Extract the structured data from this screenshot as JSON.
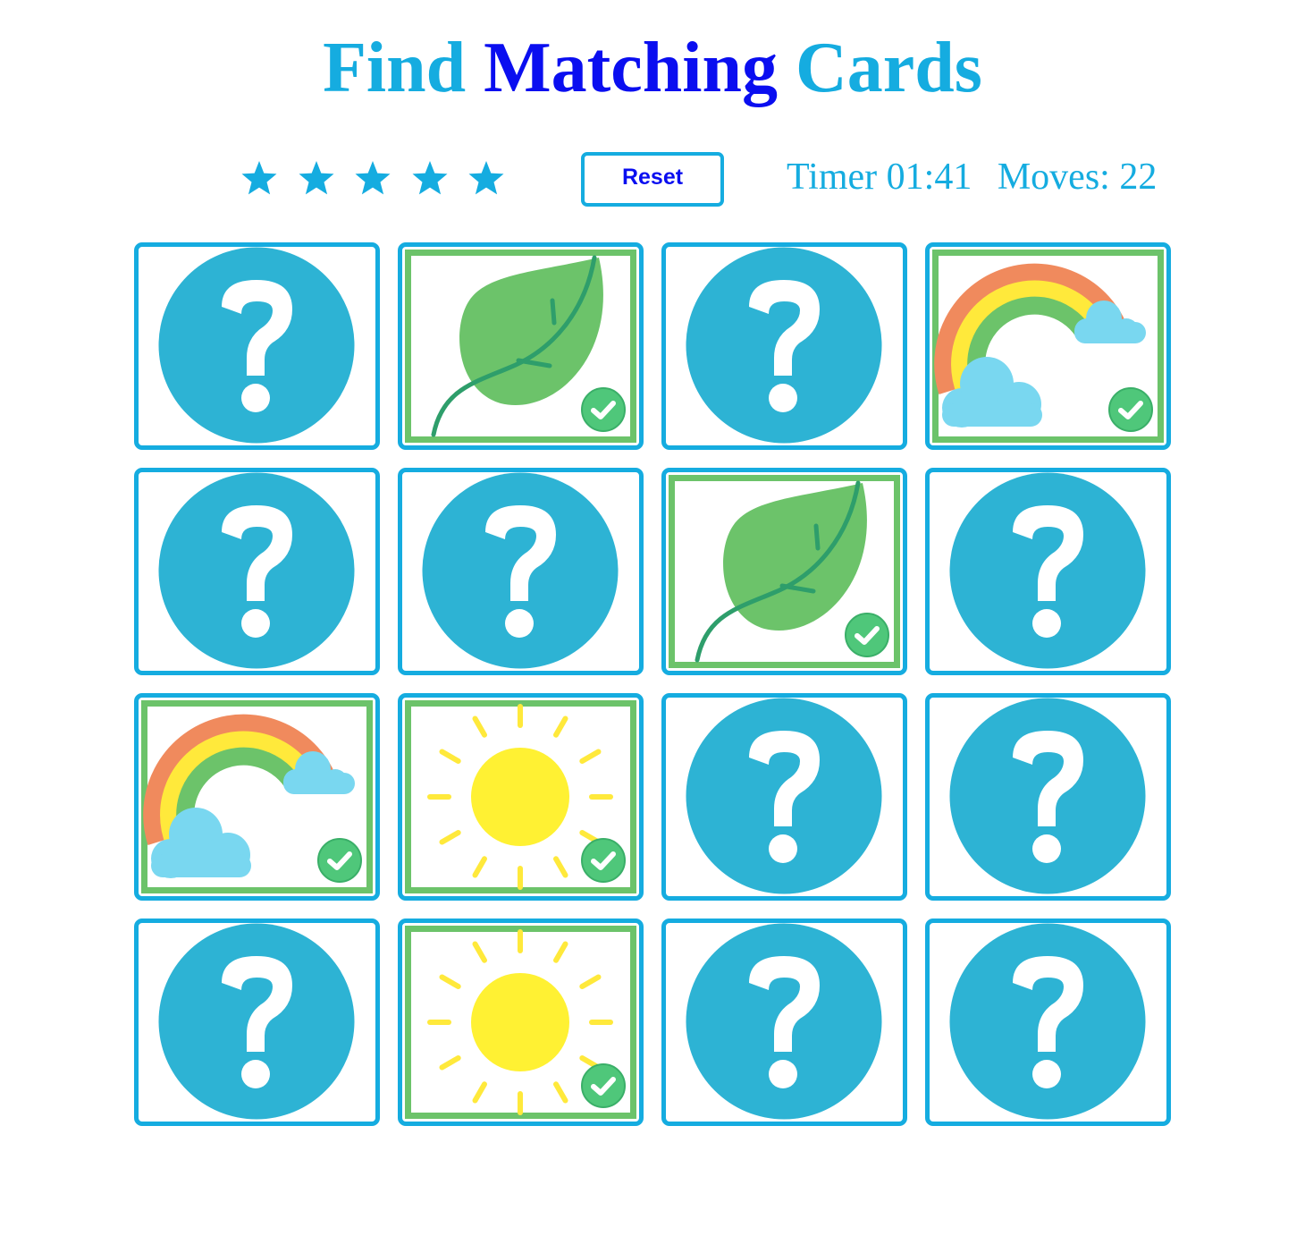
{
  "header": {
    "title_word_1": "Find",
    "title_word_2": "Matching",
    "title_word_3": "Cards"
  },
  "rating": {
    "stars": 5
  },
  "controls": {
    "reset_label": "Reset"
  },
  "stats": {
    "timer_label": "Timer",
    "timer_value": "01:41",
    "moves_label": "Moves:",
    "moves_value": "22"
  },
  "colors": {
    "accent": "#15ace0",
    "title_dark": "#0a0ef0",
    "matched_border": "#6cc36a",
    "hidden_card_circle": "#2db3d4"
  },
  "board": {
    "rows": 4,
    "cols": 4,
    "cards": [
      {
        "face": "hidden"
      },
      {
        "face": "leaf",
        "matched": true
      },
      {
        "face": "hidden"
      },
      {
        "face": "rainbow",
        "matched": true
      },
      {
        "face": "hidden"
      },
      {
        "face": "hidden"
      },
      {
        "face": "leaf",
        "matched": true
      },
      {
        "face": "hidden"
      },
      {
        "face": "rainbow",
        "matched": true
      },
      {
        "face": "sun",
        "matched": true
      },
      {
        "face": "hidden"
      },
      {
        "face": "hidden"
      },
      {
        "face": "hidden"
      },
      {
        "face": "sun",
        "matched": true
      },
      {
        "face": "hidden"
      },
      {
        "face": "hidden"
      }
    ]
  }
}
